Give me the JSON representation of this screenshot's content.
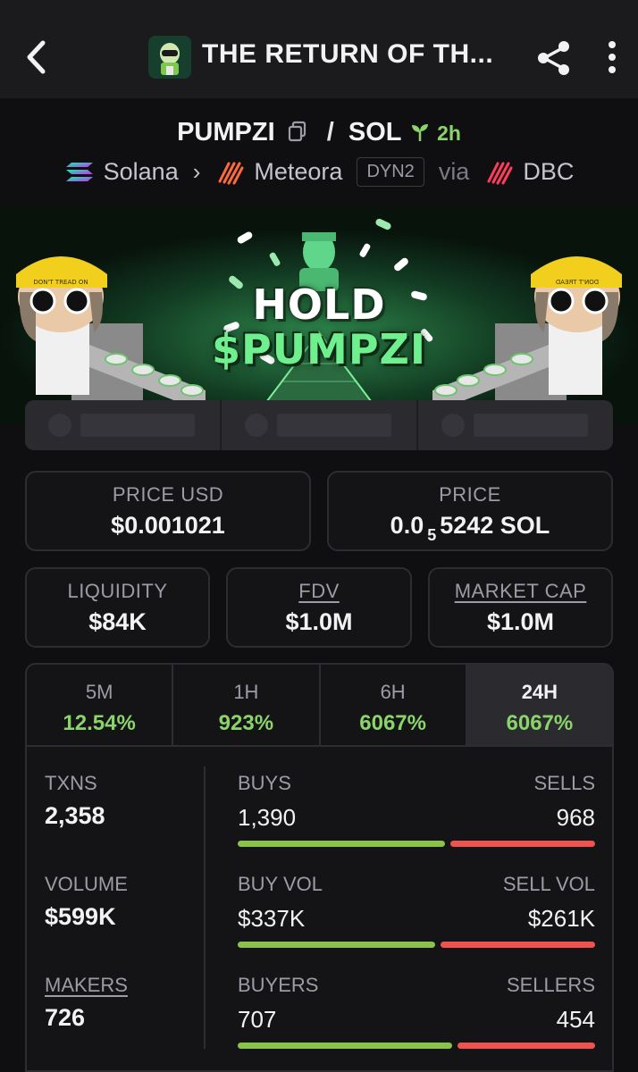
{
  "header": {
    "title": "THE RETURN OF TH...",
    "back_icon": "chevron-left-icon",
    "share_icon": "share-icon",
    "menu_icon": "kebab-menu-icon"
  },
  "pair": {
    "base": "PUMPZI",
    "quote": "SOL",
    "separator": "/",
    "age": "2h",
    "chain": "Solana",
    "dex": "Meteora",
    "dex_tag": "DYN2",
    "via": "via",
    "launchpad": "DBC"
  },
  "banner": {
    "line1": "HOLD",
    "line2": "$PUMPZI",
    "cap_text_left": "DON'T TREAD ON",
    "cap_text_right": "DON'T TREAD"
  },
  "prices": {
    "price_usd_label": "PRICE USD",
    "price_usd": "$0.001021",
    "price_label": "PRICE",
    "price_sol_prefix": "0.0",
    "price_sol_sub": "5",
    "price_sol_rest": "5242 SOL"
  },
  "metrics": {
    "liquidity_label": "LIQUIDITY",
    "liquidity": "$84K",
    "fdv_label": "FDV",
    "fdv": "$1.0M",
    "mcap_label": "MARKET CAP",
    "mcap": "$1.0M"
  },
  "timeframes": [
    {
      "label": "5M",
      "change": "12.54%"
    },
    {
      "label": "1H",
      "change": "923%"
    },
    {
      "label": "6H",
      "change": "6067%"
    },
    {
      "label": "24H",
      "change": "6067%"
    }
  ],
  "active_timeframe": "24H",
  "stats": {
    "txns_label": "TXNS",
    "txns": "2,358",
    "volume_label": "VOLUME",
    "volume": "$599K",
    "makers_label": "MAKERS",
    "makers": "726",
    "buys_label": "BUYS",
    "buys": "1,390",
    "sells_label": "SELLS",
    "sells": "968",
    "buys_fraction": 0.59,
    "buyvol_label": "BUY VOL",
    "buyvol": "$337K",
    "sellvol_label": "SELL VOL",
    "sellvol": "$261K",
    "buyvol_fraction": 0.56,
    "buyers_label": "BUYERS",
    "buyers": "707",
    "sellers_label": "SELLERS",
    "sellers": "454",
    "buyers_fraction": 0.61
  },
  "colors": {
    "positive": "#8ad46a",
    "buy_bar": "#8bc34a",
    "sell_bar": "#ef5350",
    "panel_bg": "#141417",
    "border": "#2c2c32"
  }
}
